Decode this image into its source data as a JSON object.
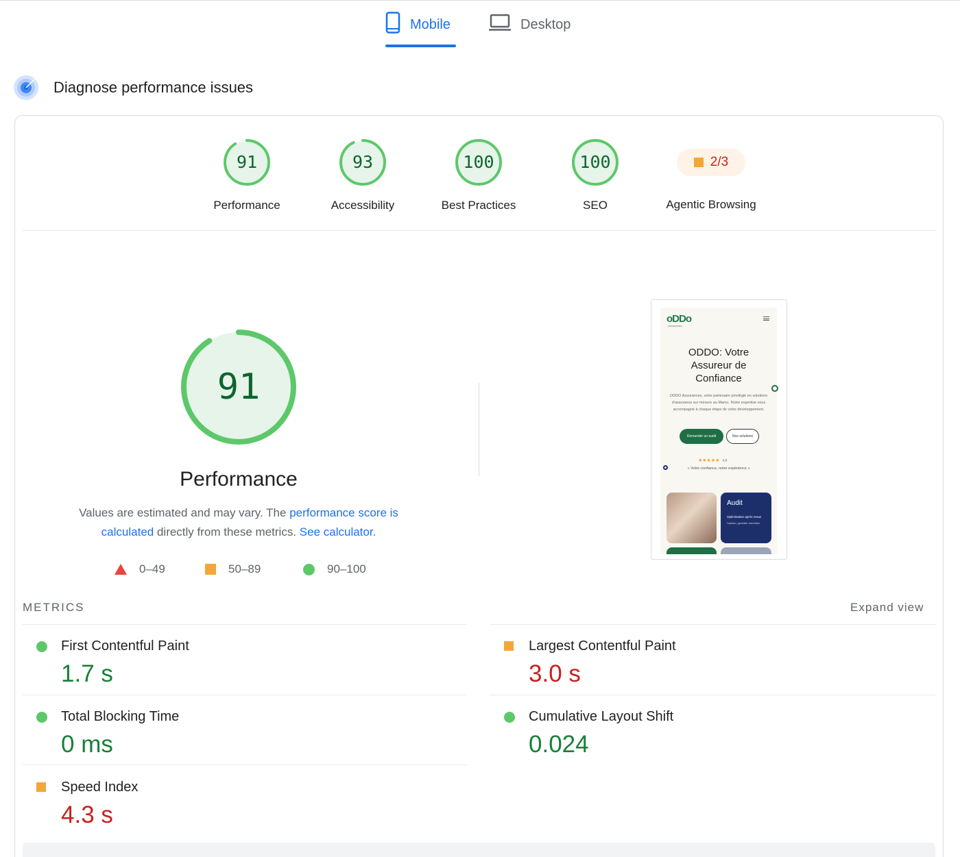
{
  "tabs": [
    {
      "label": "Mobile",
      "active": true
    },
    {
      "label": "Desktop",
      "active": false
    }
  ],
  "section": {
    "title": "Diagnose performance issues"
  },
  "scores": [
    {
      "value": "91",
      "label": "Performance"
    },
    {
      "value": "93",
      "label": "Accessibility"
    },
    {
      "value": "100",
      "label": "Best Practices"
    },
    {
      "value": "100",
      "label": "SEO"
    }
  ],
  "agentic": {
    "value": "2/3",
    "label": "Agentic Browsing"
  },
  "performance": {
    "score": "91",
    "title": "Performance",
    "note_pre": "Values are estimated and may vary. The ",
    "note_link": "performance score is calculated",
    "note_mid": " directly from these metrics. ",
    "note_link2": "See calculator."
  },
  "legend": [
    {
      "range": "0–49"
    },
    {
      "range": "50–89"
    },
    {
      "range": "90–100"
    }
  ],
  "screenshot": {
    "logo": "oDDo",
    "logo_sub": "ASSURANCES",
    "title_l1": "ODDO: Votre",
    "title_l2": "Assureur de",
    "title_l3": "Confiance",
    "text": "ODDO Assurances, votre partenaire privilégié en solutions d'assurance sur mesure au Maroc. Notre expertise vous accompagne à chaque étape de votre développement.",
    "btn_primary": "Demander un audit",
    "btn_secondary": "Nos solutions",
    "stars": "★★★★★",
    "rating": "4.8",
    "quote": "« Votre confiance, notre expérience »",
    "card_title": "Audit",
    "card_sub": "Optimisation après revue",
    "card_tags": "Capitaux, garanties, franchises"
  },
  "metrics": {
    "header": "METRICS",
    "expand": "Expand view",
    "items": [
      {
        "name": "First Contentful Paint",
        "value": "1.7 s",
        "status": "good"
      },
      {
        "name": "Largest Contentful Paint",
        "value": "3.0 s",
        "status": "average"
      },
      {
        "name": "Total Blocking Time",
        "value": "0 ms",
        "status": "good"
      },
      {
        "name": "Cumulative Layout Shift",
        "value": "0.024",
        "status": "good"
      },
      {
        "name": "Speed Index",
        "value": "4.3 s",
        "status": "average"
      }
    ]
  },
  "colors": {
    "accent": "#1a73e8",
    "good": "#0cce6b",
    "average": "#ffa400",
    "poor": "#ff4e42"
  }
}
